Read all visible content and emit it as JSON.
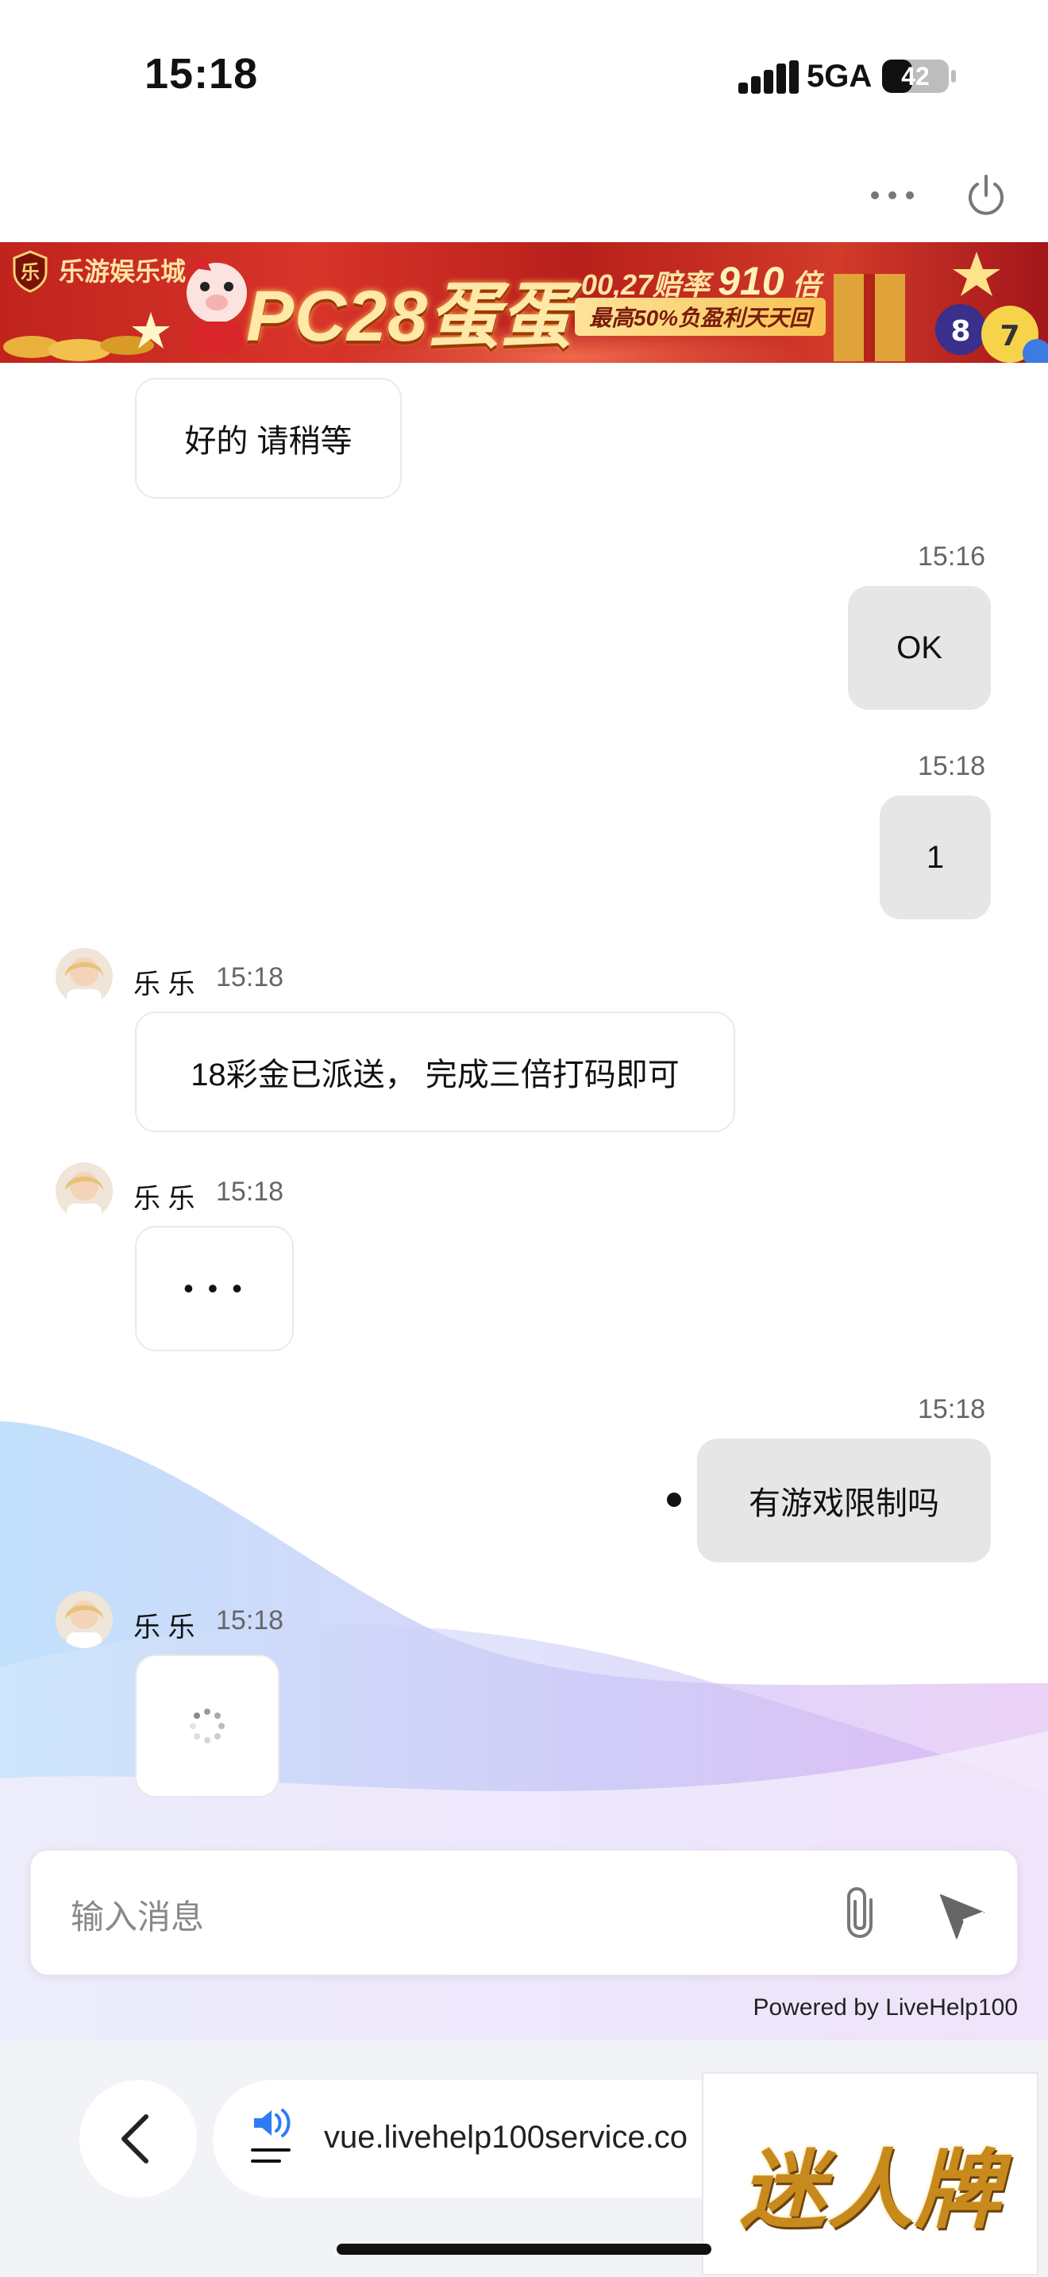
{
  "status_bar": {
    "time": "15:18",
    "network": "5GA",
    "battery": "42"
  },
  "banner": {
    "brand": "乐游娱乐城",
    "title": "PC28蛋蛋",
    "odds_prefix": "00,27赔率",
    "odds_value": "910",
    "odds_suffix": "倍",
    "subtitle": "最高50%负盈利天天回"
  },
  "chat": {
    "messages": [
      {
        "sender": "agent",
        "text": "好的 请稍等"
      },
      {
        "sender": "user",
        "time": "15:16",
        "text": "OK"
      },
      {
        "sender": "user",
        "time": "15:18",
        "text": "1"
      },
      {
        "sender": "agent",
        "name": "乐 乐",
        "time": "15:18",
        "text": "18彩金已派送， 完成三倍打码即可"
      },
      {
        "sender": "agent",
        "name": "乐 乐",
        "time": "15:18",
        "text": "• • •"
      },
      {
        "sender": "user",
        "time": "15:18",
        "text": "有游戏限制吗"
      },
      {
        "sender": "agent",
        "name": "乐 乐",
        "time": "15:18",
        "text": ""
      }
    ]
  },
  "input": {
    "placeholder": "输入消息"
  },
  "footer": {
    "powered_by": "Powered by LiveHelp100"
  },
  "browser": {
    "url": "vue.livehelp100service.co"
  },
  "ad": {
    "text": "迷人牌"
  },
  "colors": {
    "user_bubble": "#e6e6e6",
    "agent_bubble": "#ffffff",
    "banner_red": "#c0241d",
    "browser_bar": "#f2f3f6"
  }
}
